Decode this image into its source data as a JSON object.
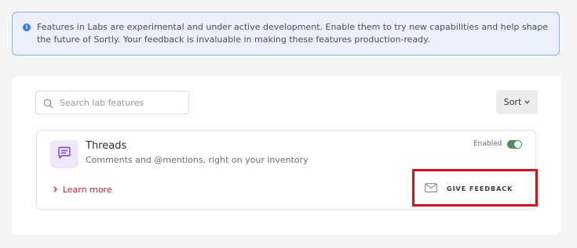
{
  "info_banner": {
    "icon": "info-icon",
    "text": "Features in Labs are experimental and under active development. Enable them to try new capabilities and help shape the future of Sortly. Your feedback is invaluable in making these features production-ready."
  },
  "toolbar": {
    "search": {
      "placeholder": "Search lab features",
      "value": ""
    },
    "sort_label": "Sort"
  },
  "features": [
    {
      "name": "Threads",
      "description": "Comments and @mentions, right on your inventory",
      "icon": "chat-bubble-icon",
      "status_label": "Enabled",
      "enabled": true,
      "learn_more_label": "Learn more",
      "feedback_label": "GIVE FEEDBACK"
    }
  ],
  "colors": {
    "info_bg": "#e9f0fb",
    "info_border": "#8fb0e6",
    "toggle_on": "#4f8e5a",
    "link": "#d21f2b",
    "highlight": "#d4121f",
    "feature_icon_bg": "#efe7fb",
    "feature_icon": "#7b3fd1"
  }
}
